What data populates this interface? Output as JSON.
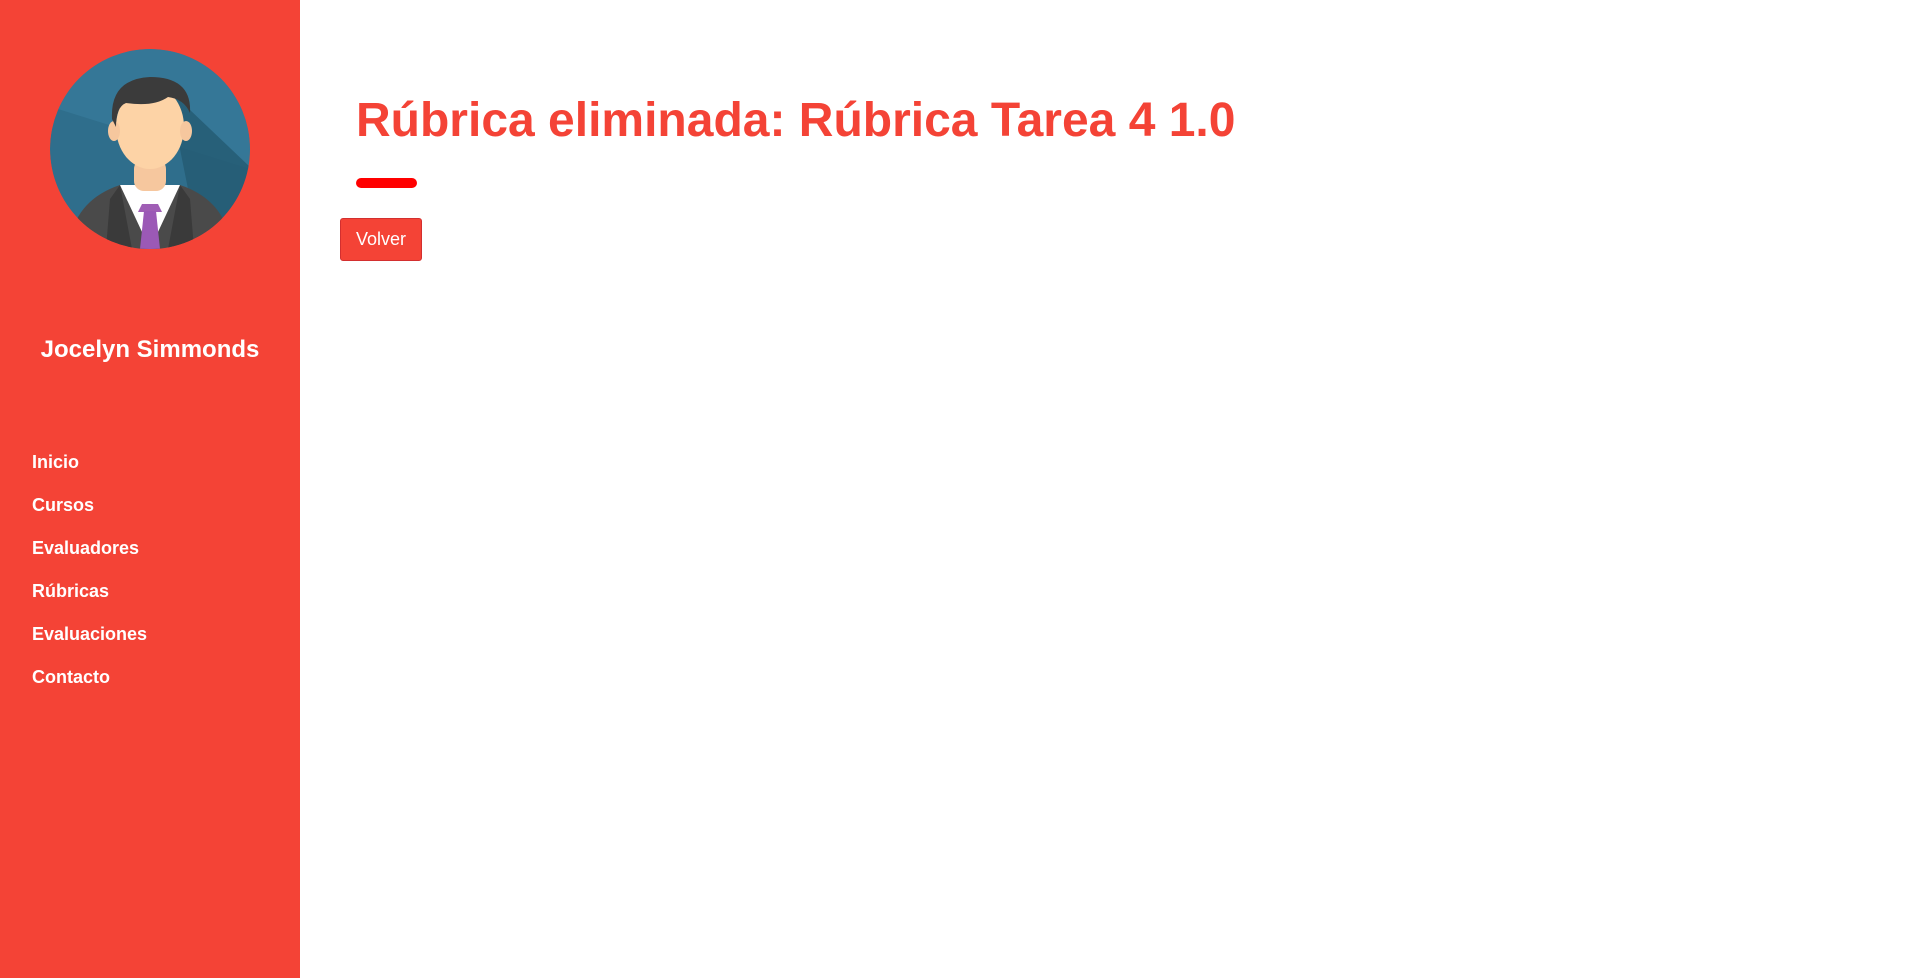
{
  "sidebar": {
    "user_name": "Jocelyn Simmonds",
    "avatar_icon": "businessman-avatar-icon",
    "nav": [
      {
        "label": "Inicio"
      },
      {
        "label": "Cursos"
      },
      {
        "label": "Evaluadores"
      },
      {
        "label": "Rúbricas"
      },
      {
        "label": "Evaluaciones"
      },
      {
        "label": "Contacto"
      }
    ]
  },
  "main": {
    "title": "Rúbrica eliminada: Rúbrica Tarea 4 1.0",
    "back_button": "Volver"
  },
  "colors": {
    "accent": "#f44336",
    "title_underline": "#ff0000",
    "text_on_accent": "#ffffff"
  }
}
